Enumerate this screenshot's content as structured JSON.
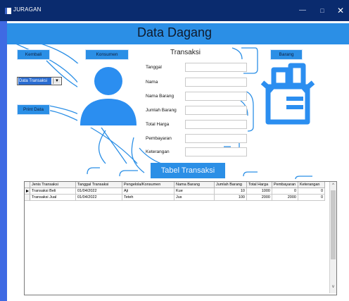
{
  "window": {
    "title": "JURAGAN",
    "minimize_glyph": "—",
    "maximize_glyph": "□",
    "close_glyph": "✕"
  },
  "header": {
    "title": "Data Dagang"
  },
  "buttons": {
    "kembali": "Kembali",
    "konsumen": "Konsumen",
    "barang": "Barang",
    "print": "Print Data"
  },
  "select": {
    "value": "Data Transaksi",
    "arrow": "▼"
  },
  "form": {
    "title": "Transaksi",
    "fields": [
      {
        "label": "Tanggal",
        "value": ""
      },
      {
        "label": "Nama",
        "value": ""
      },
      {
        "label": "Nama Barang",
        "value": ""
      },
      {
        "label": "Jumlah Barang",
        "value": ""
      },
      {
        "label": "Total Harga",
        "value": ""
      },
      {
        "label": "Pembayaran",
        "value": ""
      },
      {
        "label": "Keterangan",
        "value": ""
      }
    ]
  },
  "icons": {
    "avatar": "user-avatar-icon",
    "barang": "box-inventory-icon"
  },
  "table": {
    "title": "Tabel Transaksi",
    "columns": [
      "Jenis Transaksi",
      "Tanggal Transaksi",
      "Pengelola/Konsumen",
      "Nama Barang",
      "Jumlah Barang",
      "Total Harga",
      "Pembayaran",
      "Keterangan"
    ],
    "rows": [
      [
        "Transaksi Beli",
        "01/04/2022",
        "Aji",
        "Kue",
        "10",
        "1000",
        "0",
        "0"
      ],
      [
        "Transaksi Jual",
        "01/04/2022",
        "Teteh",
        "Jus",
        "100",
        "2000",
        "2000",
        "0"
      ]
    ],
    "scroll_up": "^",
    "scroll_down": "v"
  },
  "colors": {
    "titlebar": "#0a2b6e",
    "accent": "#2b8fe6",
    "icon": "#2b8ef0"
  }
}
